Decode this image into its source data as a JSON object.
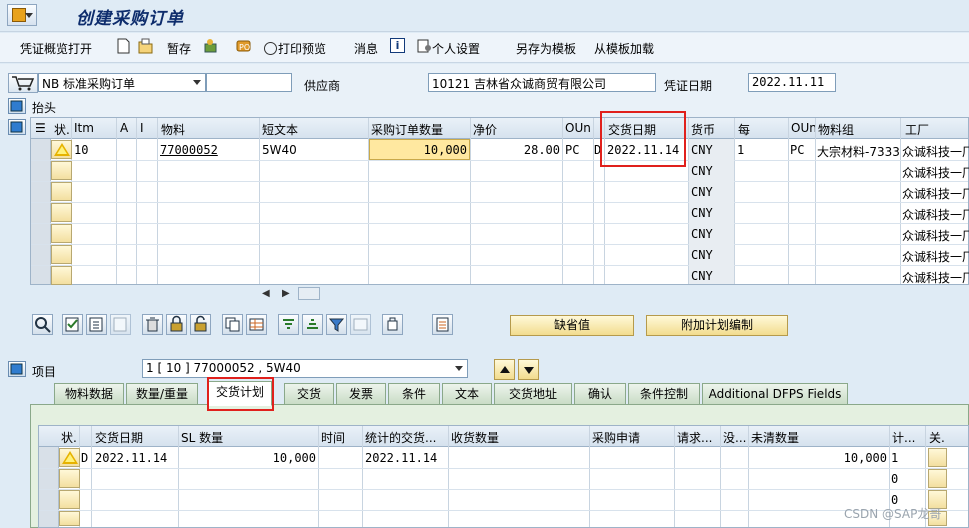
{
  "window": {
    "title": "创建采购订单"
  },
  "toolbar": {
    "items": [
      "凭证概览打开",
      "暂存",
      "打印预览",
      "消息",
      "个人设置",
      "另存为模板",
      "从模板加载"
    ]
  },
  "header": {
    "doc_type": "NB 标准采购订单",
    "doc_type_extra": "",
    "vendor_label": "供应商",
    "vendor_value": "10121 吉林省众诚商贸有限公司",
    "doc_date_label": "凭证日期",
    "doc_date_value": "2022.11.11",
    "header_section_label": "抬头"
  },
  "item_grid": {
    "columns": [
      "状.",
      "Itm",
      "A",
      "I",
      "物料",
      "短文本",
      "采购订单数量",
      "净价",
      "OUn",
      "交货日期",
      "货币",
      "每",
      "OUn",
      "物料组",
      "工厂"
    ],
    "row1": {
      "itm": "10",
      "material": "77000052",
      "short_text": "5W40",
      "qty": "10,000",
      "price": "28.00",
      "oun": "PC",
      "d": "D",
      "delivery_date": "2022.11.14",
      "currency": "CNY",
      "per": "1",
      "oun2": "PC",
      "mat_group": "大宗材料-7333",
      "plant": "众诚科技一厂"
    },
    "empty_rows": [
      {
        "currency": "CNY",
        "plant": "众诚科技一厂"
      },
      {
        "currency": "CNY",
        "plant": "众诚科技一厂"
      },
      {
        "currency": "CNY",
        "plant": "众诚科技一厂"
      },
      {
        "currency": "CNY",
        "plant": "众诚科技一厂"
      },
      {
        "currency": "CNY",
        "plant": "众诚科技一厂"
      },
      {
        "currency": "CNY",
        "plant": "众诚科技一厂"
      }
    ]
  },
  "actions": {
    "default_values_label": "缺省值",
    "additional_planning_label": "附加计划编制"
  },
  "item_detail": {
    "label": "项目",
    "selected_item": "1 [ 10 ] 77000052 , 5W40",
    "tabs": [
      "物料数据",
      "数量/重量",
      "交货计划",
      "交货",
      "发票",
      "条件",
      "文本",
      "交货地址",
      "确认",
      "条件控制",
      "Additional DFPS Fields"
    ],
    "active_tab": "交货计划"
  },
  "schedule_grid": {
    "columns": [
      "状.",
      "交货日期",
      "SL 数量",
      "时间",
      "统计的交货...",
      "收货数量",
      "采购申请",
      "请求...",
      "没...",
      "未清数量",
      "计...",
      "关."
    ],
    "row1": {
      "cat": "D",
      "delivery_date": "2022.11.14",
      "sl_qty": "10,000",
      "stat_date": "2022.11.14",
      "open_qty": "10,000",
      "calc": "1"
    },
    "row2_calc": "0",
    "row3_calc": "0"
  },
  "watermark": "CSDN @SAP龙哥",
  "colors": {
    "highlight_border": "#e0201c",
    "warning": "#e6b200",
    "qty_focus": "#ffe8a0"
  }
}
